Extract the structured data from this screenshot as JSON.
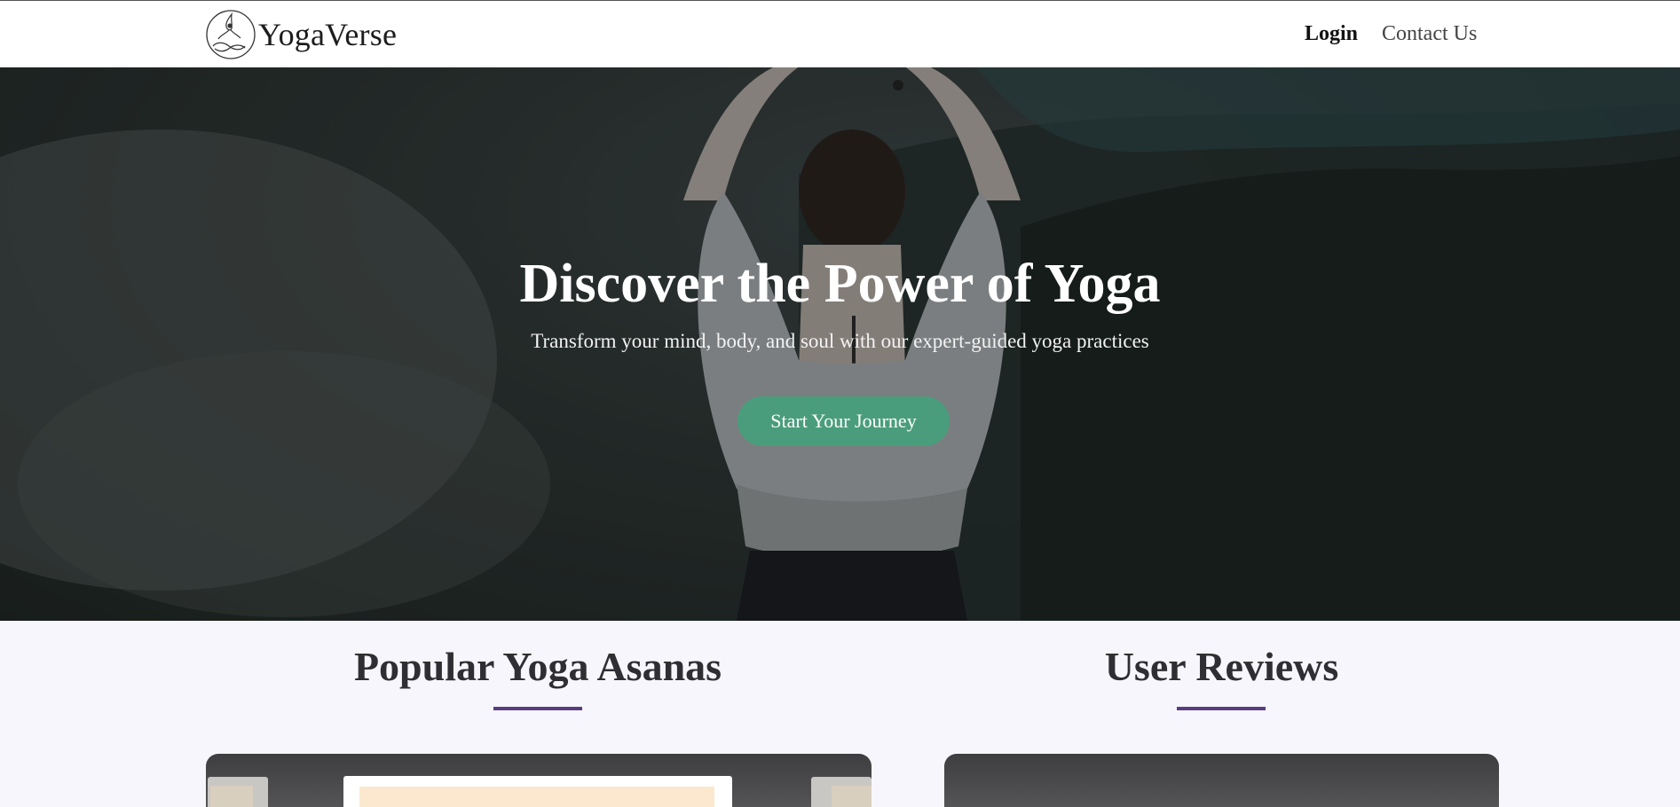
{
  "navbar": {
    "brand": "YogaVerse",
    "links": {
      "login": "Login",
      "contact": "Contact Us"
    }
  },
  "hero": {
    "title": "Discover the Power of Yoga",
    "subtitle": "Transform your mind, body, and soul with our expert-guided yoga practices",
    "cta_label": "Start Your Journey"
  },
  "sections": {
    "asanas_title": "Popular Yoga Asanas",
    "reviews_title": "User Reviews"
  },
  "colors": {
    "accent_green": "#4a9d7c",
    "underline_purple": "#5a3d80",
    "page_background": "#f7f6fc"
  },
  "icons": {
    "logo": "meditation-lotus-icon"
  }
}
